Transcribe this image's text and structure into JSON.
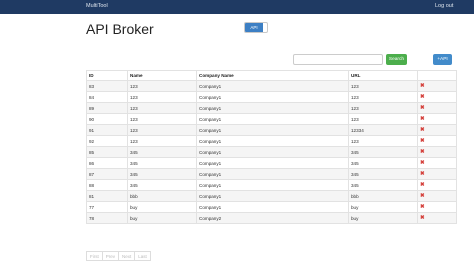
{
  "navbar": {
    "brand": "MultiTool",
    "logout": "Log out"
  },
  "page": {
    "title": "API Broker"
  },
  "toggle": {
    "label": "API"
  },
  "search": {
    "placeholder": "",
    "button_label": "Search"
  },
  "add_button_label": "+API",
  "colors": {
    "navbar": "#1f3a63",
    "primary": "#428bca",
    "success": "#4cae4c",
    "danger": "#d43f3a"
  },
  "table": {
    "headers": [
      "ID",
      "Name",
      "Company Name",
      "URL",
      ""
    ],
    "rows": [
      [
        "83",
        "123",
        "Company1",
        "123"
      ],
      [
        "84",
        "123",
        "Company1",
        "123"
      ],
      [
        "89",
        "123",
        "Company1",
        "123"
      ],
      [
        "90",
        "123",
        "Company1",
        "123"
      ],
      [
        "91",
        "123",
        "Company1",
        "12334"
      ],
      [
        "92",
        "123",
        "Company1",
        "123"
      ],
      [
        "85",
        "345",
        "Company1",
        "345"
      ],
      [
        "86",
        "345",
        "Company1",
        "345"
      ],
      [
        "87",
        "345",
        "Company1",
        "345"
      ],
      [
        "88",
        "345",
        "Company1",
        "345"
      ],
      [
        "81",
        "bbb",
        "Company1",
        "bbb"
      ],
      [
        "77",
        "buy",
        "Company1",
        "buy"
      ],
      [
        "78",
        "buy",
        "Company2",
        "buy"
      ]
    ],
    "delete_icon": "✖"
  },
  "pagination": [
    "First",
    "Prev",
    "Next",
    "Last"
  ]
}
